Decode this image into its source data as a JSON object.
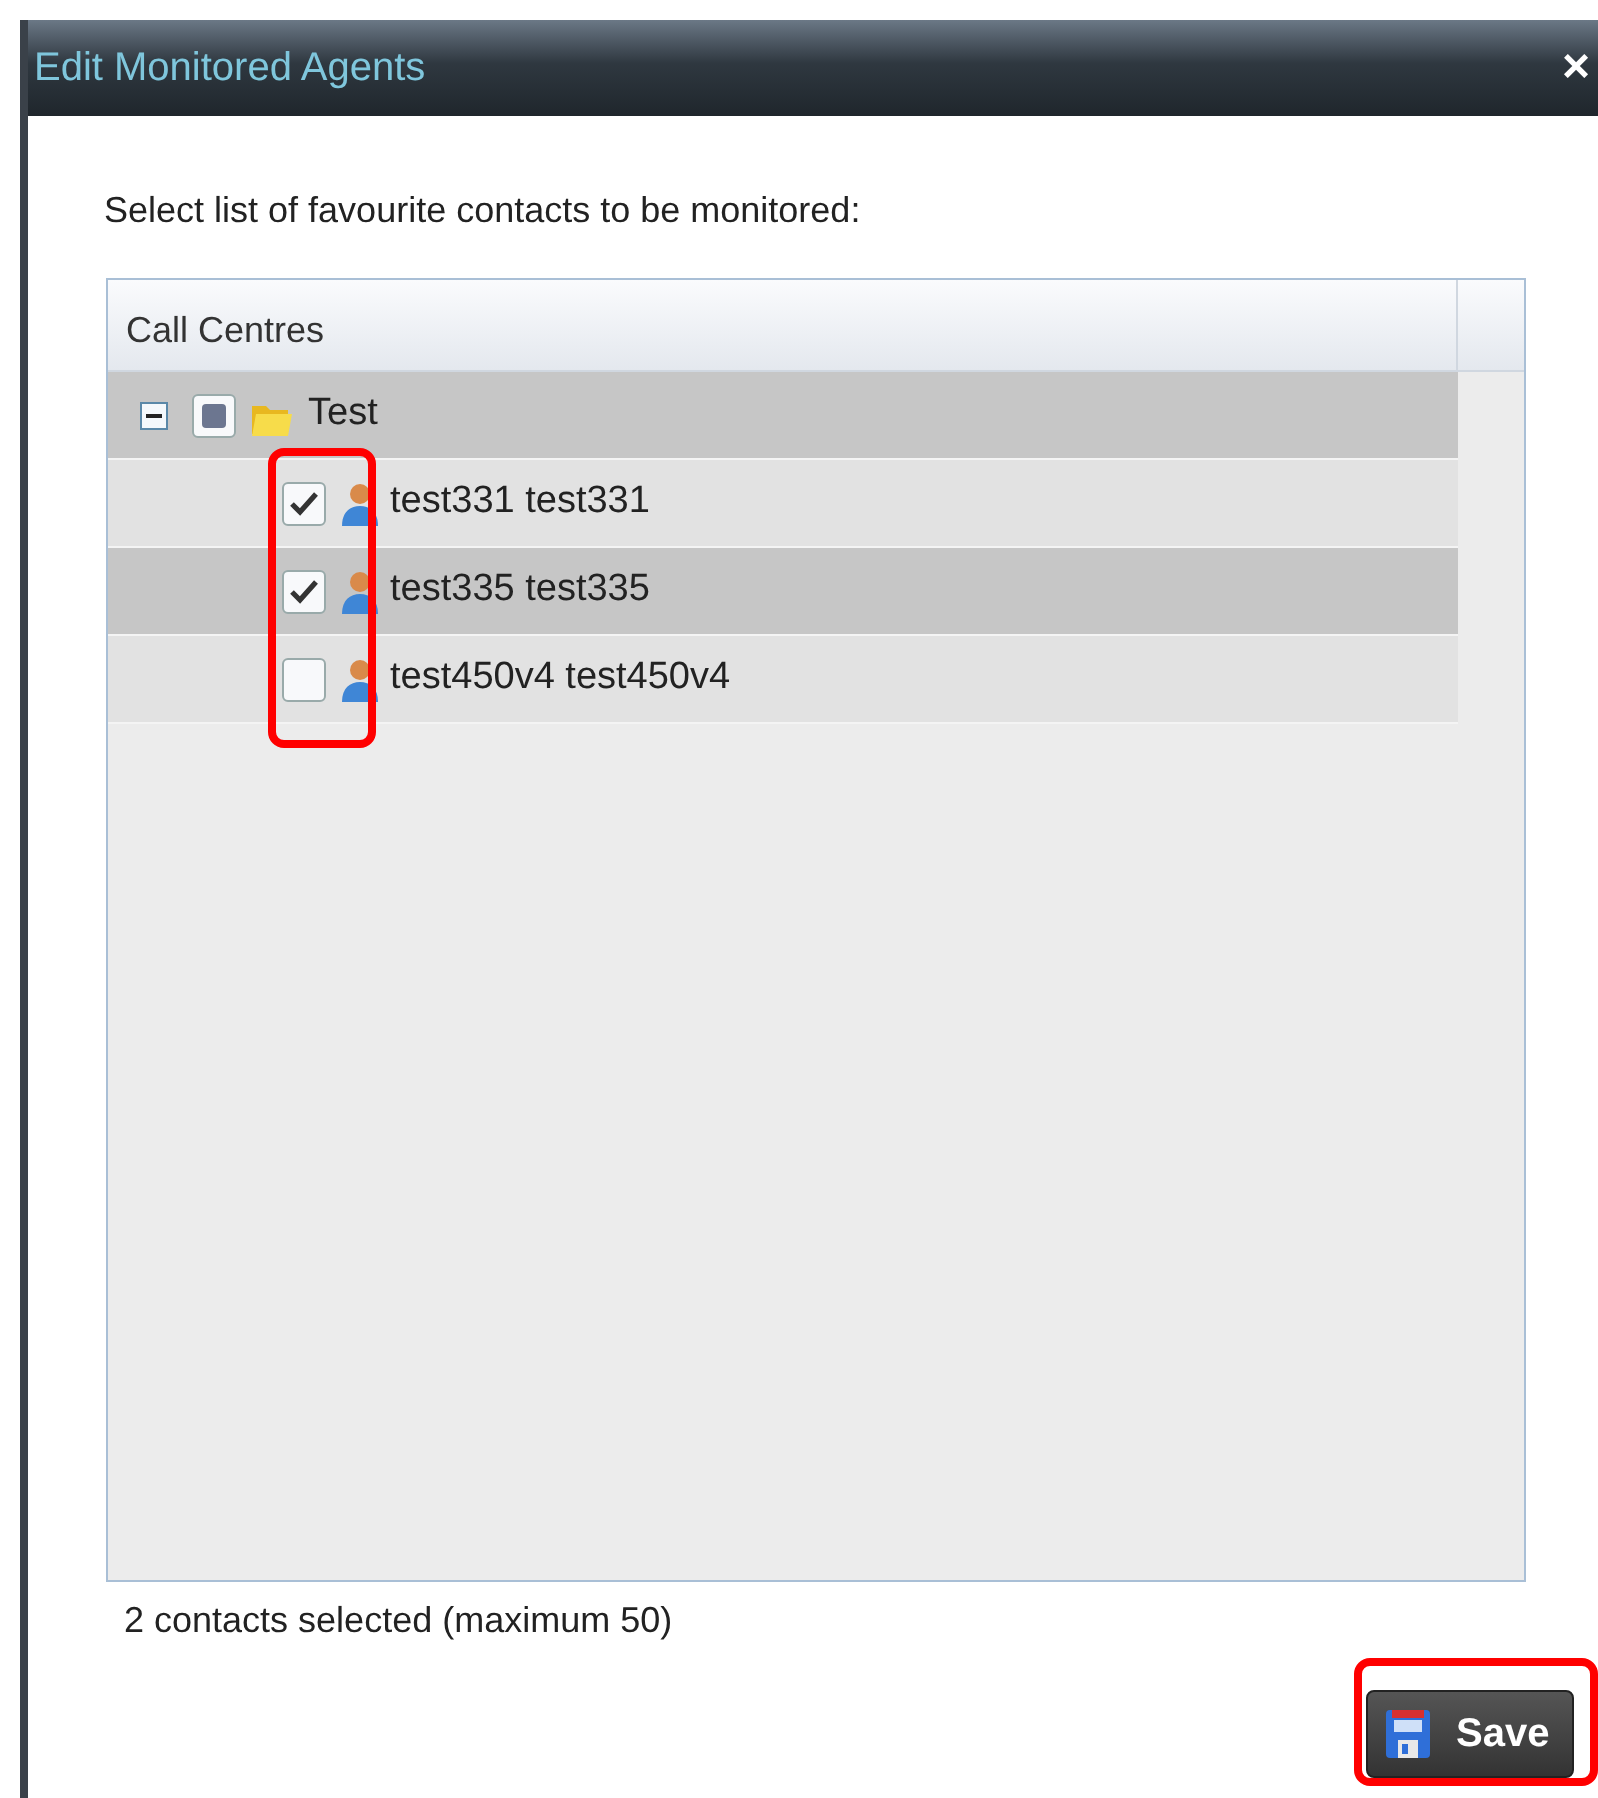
{
  "window": {
    "title": "Edit Monitored Agents",
    "close": "×"
  },
  "instruction": "Select list of favourite contacts to be monitored:",
  "tree": {
    "column": "Call Centres",
    "checkboxes_highlighted": true,
    "items": [
      {
        "label": "Test",
        "kind": "folder",
        "expanded": true,
        "partial": true,
        "selected": true,
        "children": [
          {
            "label": "test331 test331",
            "kind": "agent",
            "checked": true,
            "selected": false
          },
          {
            "label": "test335 test335",
            "kind": "agent",
            "checked": true,
            "selected": true
          },
          {
            "label": "test450v4 test450v4",
            "kind": "agent",
            "checked": false,
            "selected": false
          }
        ]
      }
    ]
  },
  "status": "2 contacts selected (maximum 50)",
  "save_button": {
    "label": "Save",
    "highlighted": true
  }
}
